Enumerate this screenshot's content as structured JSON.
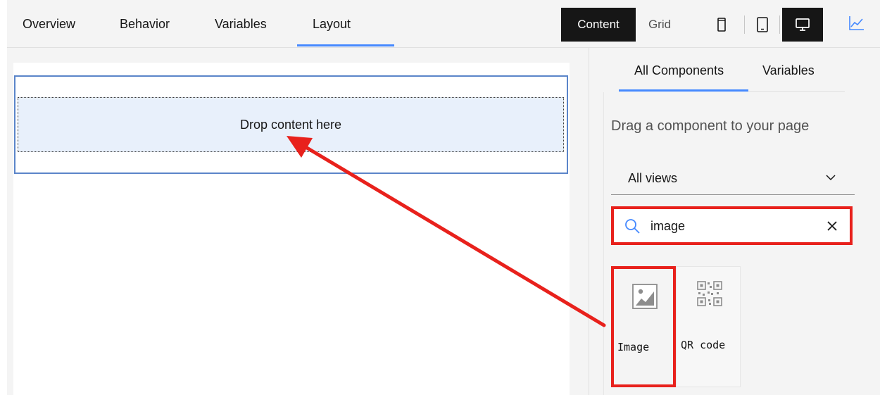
{
  "tabs": [
    {
      "label": "Overview",
      "active": false
    },
    {
      "label": "Behavior",
      "active": false
    },
    {
      "label": "Variables",
      "active": false
    },
    {
      "label": "Layout",
      "active": true
    }
  ],
  "view_toggle": {
    "content": "Content",
    "grid": "Grid",
    "selected": "Content"
  },
  "devices": [
    {
      "icon": "mobile-icon",
      "active": false
    },
    {
      "icon": "tablet-icon",
      "active": false
    },
    {
      "icon": "desktop-icon",
      "active": true
    }
  ],
  "canvas": {
    "dropzone_text": "Drop content here"
  },
  "panel": {
    "tabs": [
      {
        "label": "All Components",
        "active": true
      },
      {
        "label": "Variables",
        "active": false
      }
    ],
    "hint": "Drag a component to your page",
    "filter": {
      "selected": "All views"
    },
    "search": {
      "value": "image"
    },
    "components": [
      {
        "label": "Image",
        "icon": "image-icon"
      },
      {
        "label": "QR code",
        "icon": "qr-code-icon"
      }
    ]
  },
  "colors": {
    "accent": "#4589ff",
    "highlight": "#e8211c",
    "dark": "#161616",
    "dropzone": "#e8f0fb"
  }
}
